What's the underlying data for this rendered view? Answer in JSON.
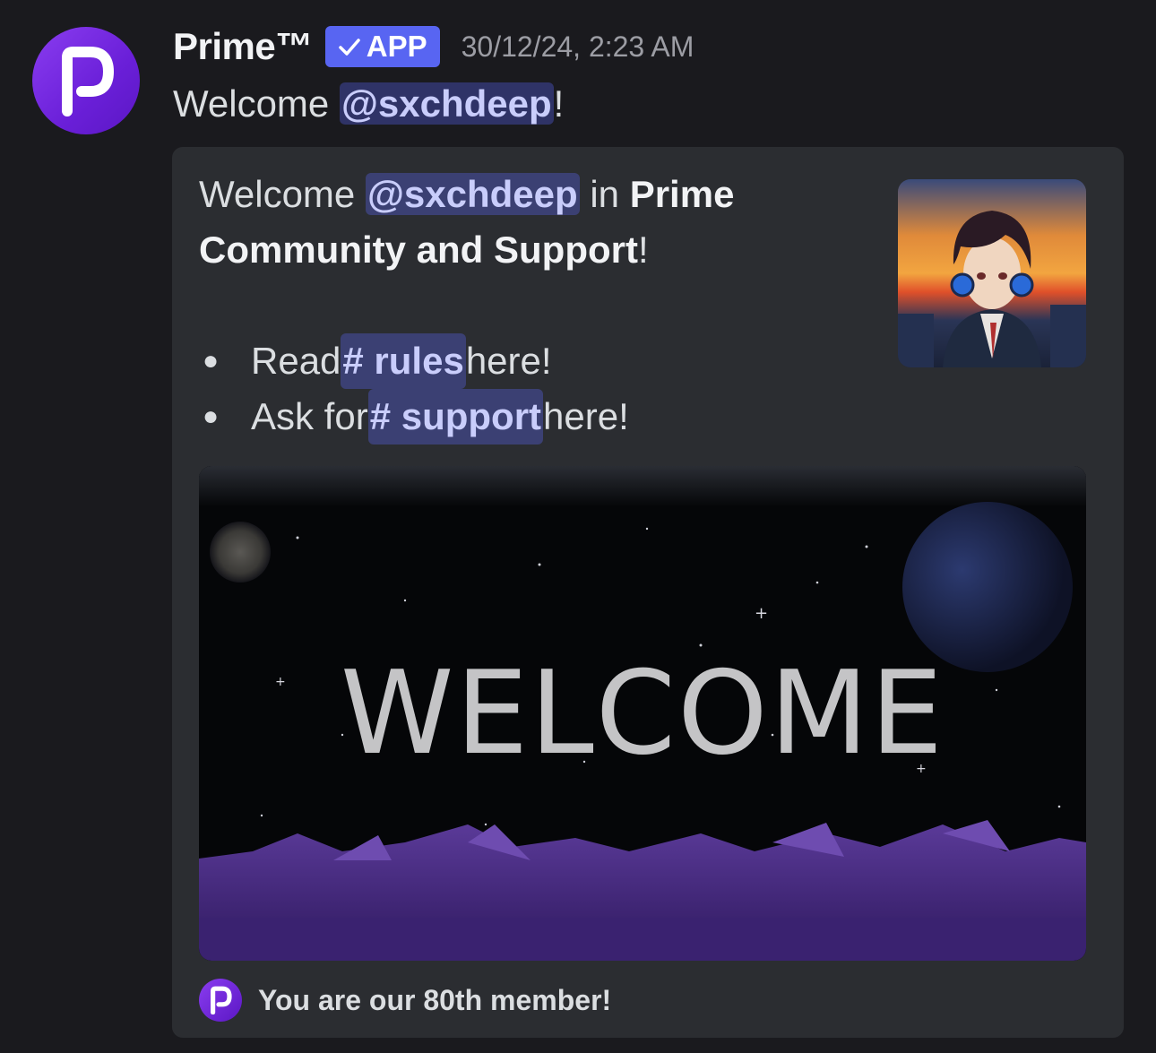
{
  "message": {
    "author": "Prime™",
    "badge": "APP",
    "timestamp": "30/12/24, 2:23 AM",
    "text_prefix": "Welcome ",
    "mention": "@sxchdeep",
    "text_suffix": "!"
  },
  "embed": {
    "desc_welcome": "Welcome ",
    "mention": "@sxchdeep",
    "desc_in": " in ",
    "server_name": "Prime Community and Support",
    "desc_end": "!",
    "bullets": [
      {
        "prefix": "Read ",
        "channel": "# rules",
        "suffix": " here!"
      },
      {
        "prefix": "Ask for ",
        "channel": "# support",
        "suffix": " here!"
      }
    ],
    "banner_text": "WELCOME",
    "footer": "You are our 80th member!"
  },
  "colors": {
    "background": "#1a1a1e",
    "embed_bg": "#2b2d31",
    "accent": "#5865f2",
    "brand_purple": "#7a2ee6"
  }
}
